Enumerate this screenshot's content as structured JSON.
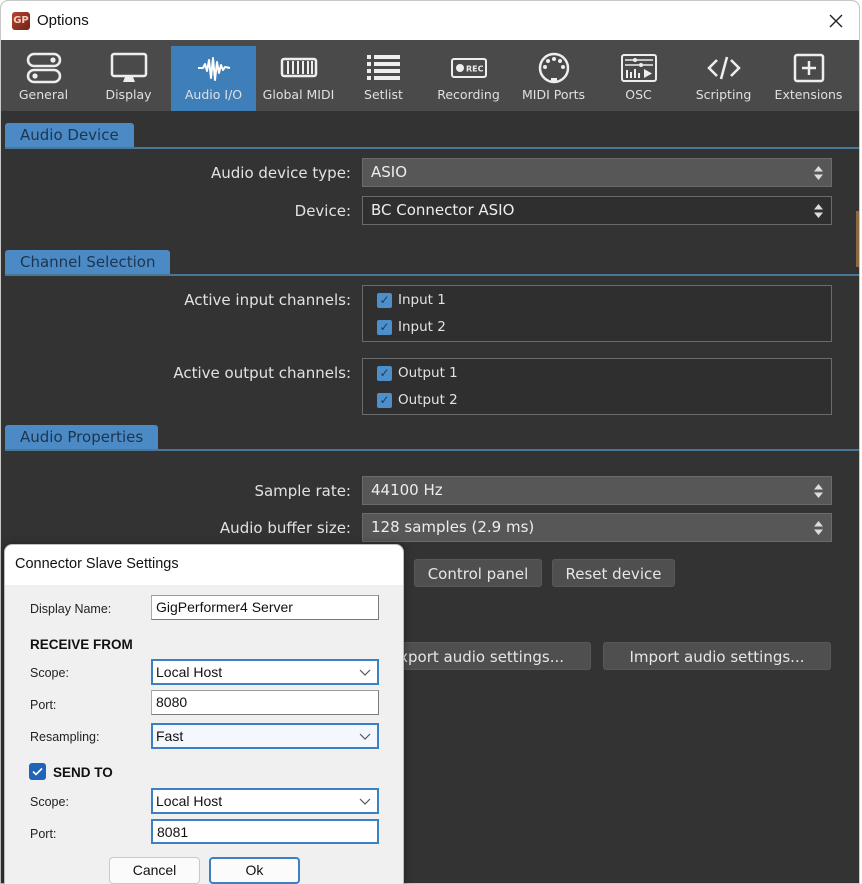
{
  "window": {
    "title": "Options",
    "app_icon_glyph": "GP"
  },
  "toolbar": {
    "items": [
      {
        "label": "General",
        "icon": "toggles-icon",
        "active": false
      },
      {
        "label": "Display",
        "icon": "monitor-icon",
        "active": false
      },
      {
        "label": "Audio I/O",
        "icon": "waveform-icon",
        "active": true
      },
      {
        "label": "Global MIDI",
        "icon": "keyboard-icon",
        "active": false
      },
      {
        "label": "Setlist",
        "icon": "list-icon",
        "active": false
      },
      {
        "label": "Recording",
        "icon": "rec-icon",
        "active": false
      },
      {
        "label": "MIDI Ports",
        "icon": "midi-din-icon",
        "active": false
      },
      {
        "label": "OSC",
        "icon": "osc-icon",
        "active": false
      },
      {
        "label": "Scripting",
        "icon": "code-icon",
        "active": false
      },
      {
        "label": "Extensions",
        "icon": "plus-box-icon",
        "active": false
      }
    ],
    "active_color": "#3f7fb9"
  },
  "sections": {
    "audio_device": "Audio Device",
    "channel_selection": "Channel Selection",
    "audio_properties": "Audio Properties"
  },
  "audio_device": {
    "type_label": "Audio device type:",
    "type_value": "ASIO",
    "device_label": "Device:",
    "device_value": "BC Connector ASIO"
  },
  "channels": {
    "input_label": "Active input channels:",
    "inputs": [
      {
        "label": "Input 1",
        "checked": true
      },
      {
        "label": "Input 2",
        "checked": true
      }
    ],
    "output_label": "Active output channels:",
    "outputs": [
      {
        "label": "Output 1",
        "checked": true
      },
      {
        "label": "Output 2",
        "checked": true
      }
    ]
  },
  "audio_properties": {
    "sample_rate_label": "Sample rate:",
    "sample_rate_value": "44100 Hz",
    "buffer_label": "Audio buffer size:",
    "buffer_value": "128 samples (2.9 ms)",
    "control_panel_button": "Control panel",
    "reset_device_button": "Reset device",
    "export_button": "Export audio settings...",
    "import_button": "Import audio settings..."
  },
  "dialog": {
    "title": "Connector Slave Settings",
    "display_name_label": "Display Name:",
    "display_name_value": "GigPerformer4 Server",
    "receive_heading": "RECEIVE FROM",
    "receive_scope_label": "Scope:",
    "receive_scope_value": "Local Host",
    "receive_port_label": "Port:",
    "receive_port_value": "8080",
    "resampling_label": "Resampling:",
    "resampling_value": "Fast",
    "send_heading": "SEND TO",
    "send_checked": true,
    "send_scope_label": "Scope:",
    "send_scope_value": "Local Host",
    "send_port_label": "Port:",
    "send_port_value": "8081",
    "cancel_button": "Cancel",
    "ok_button": "Ok"
  }
}
